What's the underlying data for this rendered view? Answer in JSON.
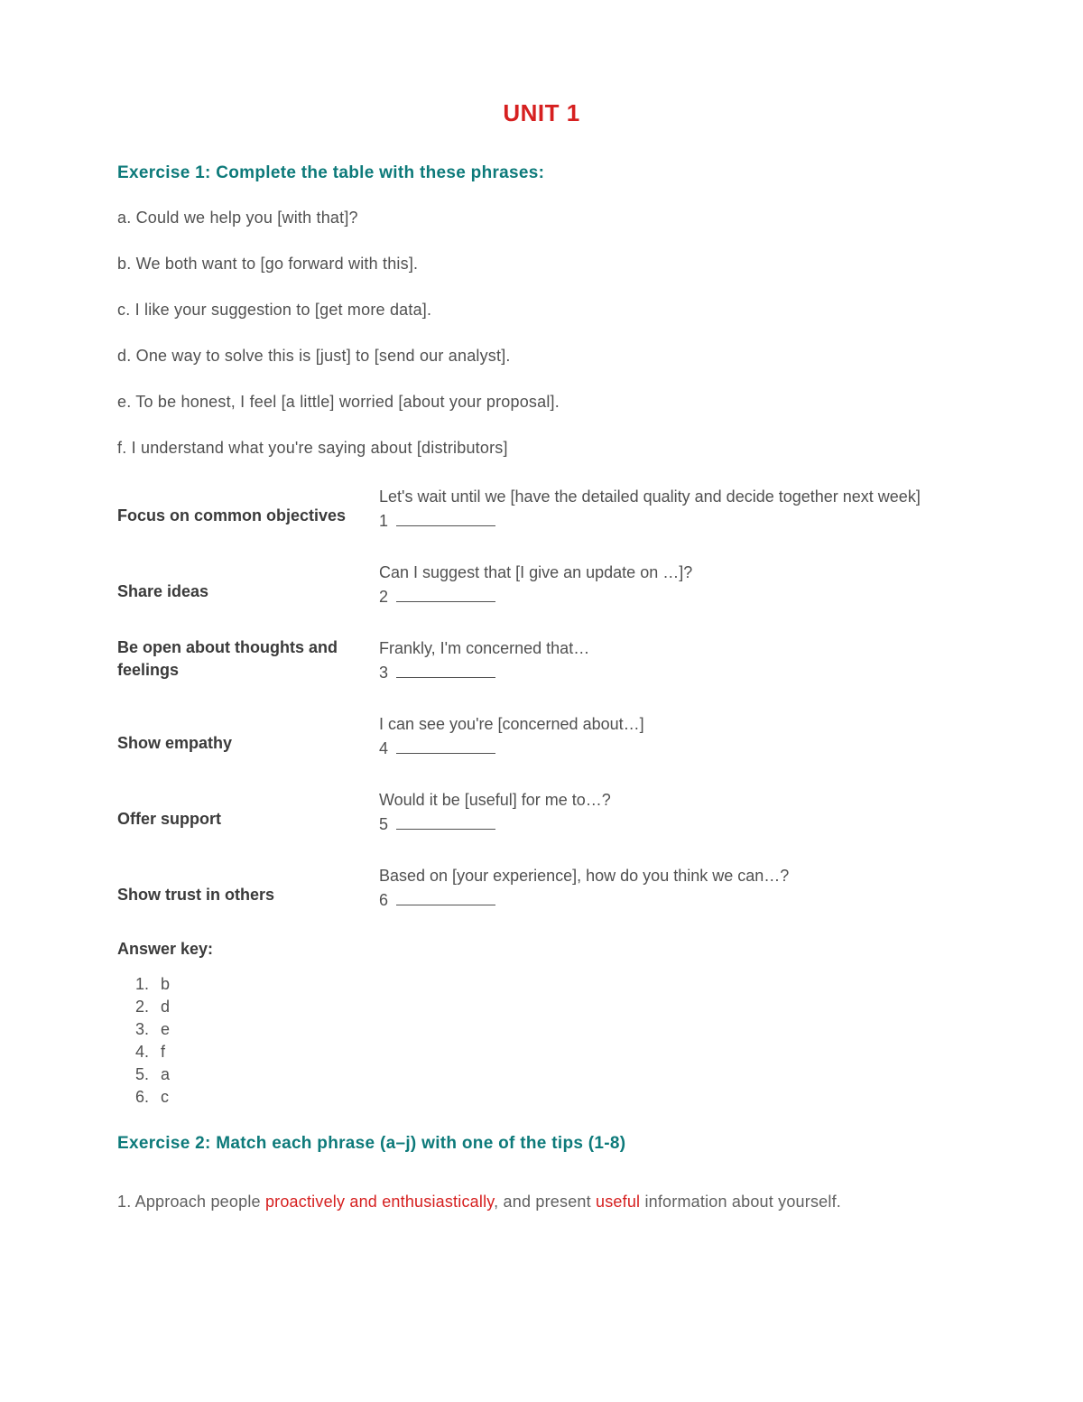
{
  "unit_title": "UNIT 1",
  "exercise1": {
    "heading": "Exercise 1: Complete the table with these phrases:",
    "phrases": {
      "a": "a. Could we help you [with that]?",
      "b": "b. We both want to [go forward with this].",
      "c": "c. I like your suggestion to [get more data].",
      "d": "d. One way to solve this is [just] to [send our analyst].",
      "e": "e. To be honest, I feel [a little] worried [about your proposal].",
      "f": "f. I understand what you're saying about [distributors]"
    },
    "rows": [
      {
        "label": "Focus on common objectives",
        "example": "Let's wait until we [have the detailed quality and decide together next week]",
        "num": "1"
      },
      {
        "label": "Share ideas",
        "example": "Can I suggest that [I give an update on …]?",
        "num": "2"
      },
      {
        "label": "Be open about thoughts and feelings",
        "example": "Frankly, I'm concerned that…",
        "num": "3"
      },
      {
        "label": "Show empathy",
        "example": "I can see you're [concerned about…]",
        "num": "4"
      },
      {
        "label": "Offer support",
        "example": "Would it be [useful] for me to…?",
        "num": "5"
      },
      {
        "label": "Show trust in others",
        "example": "Based on [your experience], how do you think we can…?",
        "num": "6"
      }
    ],
    "answer_key_label": "Answer key:",
    "answers": [
      "b",
      "d",
      "e",
      "f",
      "a",
      "c"
    ]
  },
  "exercise2": {
    "heading": "Exercise 2: Match each phrase (a–j) with one of the tips (1-8)",
    "item1": {
      "lead": "1. Approach people ",
      "hl1": "proactively and enthusiastically",
      "mid": ", and present ",
      "hl2": "useful",
      "tail": " information about yourself."
    }
  }
}
